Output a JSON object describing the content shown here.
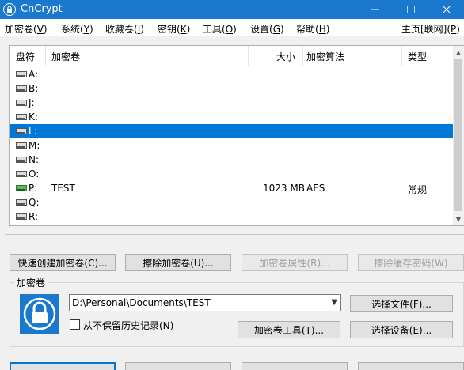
{
  "window": {
    "title": "CnCrypt"
  },
  "menu": {
    "items": [
      {
        "label": "加密卷(",
        "key": "V",
        "tail": ")"
      },
      {
        "label": "系统(",
        "key": "Y",
        "tail": ")"
      },
      {
        "label": "收藏卷(",
        "key": "I",
        "tail": ")"
      },
      {
        "label": "密钥(",
        "key": "K",
        "tail": ")"
      },
      {
        "label": "工具(",
        "key": "O",
        "tail": ")"
      },
      {
        "label": "设置(",
        "key": "G",
        "tail": ")"
      },
      {
        "label": "帮助(",
        "key": "H",
        "tail": ")"
      }
    ],
    "right": {
      "label": "主页[联网](",
      "key": "P",
      "tail": ")"
    }
  },
  "drive_list": {
    "columns": [
      "盘符",
      "加密卷",
      "大小",
      "加密算法",
      "类型"
    ],
    "rows": [
      {
        "drive": "A:",
        "volume": "",
        "size": "",
        "algorithm": "",
        "type": ""
      },
      {
        "drive": "B:",
        "volume": "",
        "size": "",
        "algorithm": "",
        "type": ""
      },
      {
        "drive": "J:",
        "volume": "",
        "size": "",
        "algorithm": "",
        "type": ""
      },
      {
        "drive": "K:",
        "volume": "",
        "size": "",
        "algorithm": "",
        "type": ""
      },
      {
        "drive": "L:",
        "volume": "",
        "size": "",
        "algorithm": "",
        "type": ""
      },
      {
        "drive": "M:",
        "volume": "",
        "size": "",
        "algorithm": "",
        "type": ""
      },
      {
        "drive": "N:",
        "volume": "",
        "size": "",
        "algorithm": "",
        "type": ""
      },
      {
        "drive": "O:",
        "volume": "",
        "size": "",
        "algorithm": "",
        "type": ""
      },
      {
        "drive": "P:",
        "volume": "TEST",
        "size": "1023 MB",
        "algorithm": "AES",
        "type": "常规"
      },
      {
        "drive": "Q:",
        "volume": "",
        "size": "",
        "algorithm": "",
        "type": ""
      },
      {
        "drive": "R:",
        "volume": "",
        "size": "",
        "algorithm": "",
        "type": ""
      }
    ],
    "selected_drive": "L:",
    "mounted_drive": "P:"
  },
  "buttons": {
    "quick_create": "快速创建加密卷(C)...",
    "remove_volume": "擦除加密卷(U)...",
    "volume_properties": "加密卷属性(R)...",
    "wipe_cache": "擦除缓存密码(W)"
  },
  "volume_group": {
    "title": "加密卷",
    "path": "D:\\Personal\\Documents\\TEST",
    "never_save_history": "从不保留历史记录(N)",
    "select_file": "选择文件(F)...",
    "volume_tools": "加密卷工具(T)...",
    "select_device": "选择设备(E)..."
  },
  "colors": {
    "titlebar": "#1a79cc",
    "selection": "#0078d7",
    "lock_tile": "#1a79cc"
  }
}
